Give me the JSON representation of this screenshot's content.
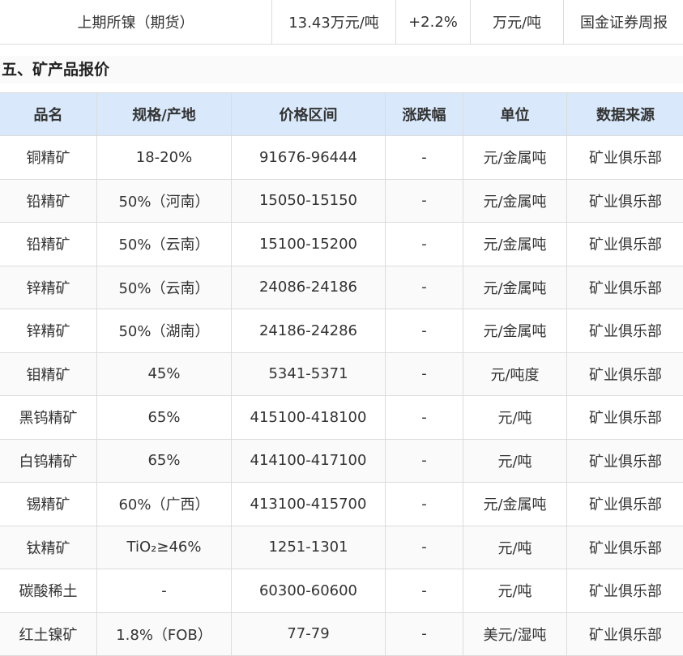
{
  "top_row": {
    "name": "上期所镍（期货）",
    "price": "13.43万元/吨",
    "change": "+2.2%",
    "unit": "万元/吨",
    "source": "国金证券周报"
  },
  "section": {
    "title": "五、矿产品报价"
  },
  "table": {
    "headers": [
      "品名",
      "规格/产地",
      "价格区间",
      "涨跌幅",
      "单位",
      "数据来源"
    ],
    "rows": [
      [
        "铜精矿",
        "18-20%",
        "91676-96444",
        "-",
        "元/金属吨",
        "矿业俱乐部"
      ],
      [
        "铅精矿",
        "50%（河南）",
        "15050-15150",
        "-",
        "元/金属吨",
        "矿业俱乐部"
      ],
      [
        "铅精矿",
        "50%（云南）",
        "15100-15200",
        "-",
        "元/金属吨",
        "矿业俱乐部"
      ],
      [
        "锌精矿",
        "50%（云南）",
        "24086-24186",
        "-",
        "元/金属吨",
        "矿业俱乐部"
      ],
      [
        "锌精矿",
        "50%（湖南）",
        "24186-24286",
        "-",
        "元/金属吨",
        "矿业俱乐部"
      ],
      [
        "钼精矿",
        "45%",
        "5341-5371",
        "-",
        "元/吨度",
        "矿业俱乐部"
      ],
      [
        "黑钨精矿",
        "65%",
        "415100-418100",
        "-",
        "元/吨",
        "矿业俱乐部"
      ],
      [
        "白钨精矿",
        "65%",
        "414100-417100",
        "-",
        "元/吨",
        "矿业俱乐部"
      ],
      [
        "锡精矿",
        "60%（广西）",
        "413100-415700",
        "-",
        "元/金属吨",
        "矿业俱乐部"
      ],
      [
        "钛精矿",
        "TiO₂≥46%",
        "1251-1301",
        "-",
        "元/吨",
        "矿业俱乐部"
      ],
      [
        "碳酸稀土",
        "-",
        "60300-60600",
        "-",
        "元/吨",
        "矿业俱乐部"
      ],
      [
        "红土镍矿",
        "1.8%（FOB）",
        "77-79",
        "-",
        "美元/湿吨",
        "矿业俱乐部"
      ]
    ]
  }
}
